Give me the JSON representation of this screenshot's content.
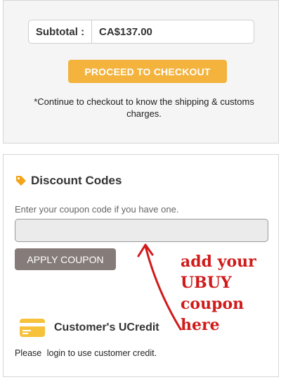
{
  "summary": {
    "subtotal_label": "Subtotal :",
    "subtotal_value": "CA$137.00",
    "checkout_label": "PROCEED TO CHECKOUT",
    "shipping_note": "*Continue to checkout to know the shipping & customs charges."
  },
  "discount": {
    "title": "Discount Codes",
    "hint": "Enter your coupon code if you have one.",
    "coupon_value": "",
    "apply_label": "APPLY COUPON",
    "tag_icon": "tag-icon"
  },
  "ucredit": {
    "title": "Customer's UCredit",
    "card_icon": "credit-card-icon",
    "login_prefix": "Please",
    "login_link": "login",
    "login_suffix": "to use customer credit."
  },
  "annotation": {
    "text": "add your UBUY coupon here",
    "color": "#d11a1a"
  },
  "colors": {
    "checkout_button": "#f3b33d",
    "apply_button": "#857b78",
    "accent_icon": "#f3a51a"
  }
}
